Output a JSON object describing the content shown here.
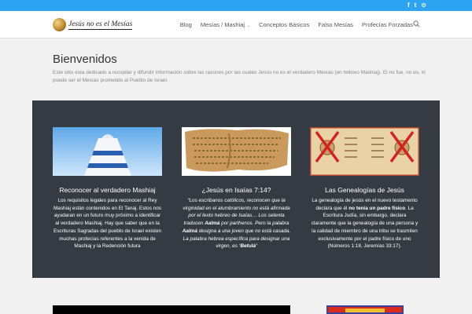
{
  "colors": {
    "accent": "#2ea3f2",
    "dark_panel": "#353b43"
  },
  "topbar": {
    "social": [
      {
        "icon": "facebook-icon",
        "glyph": "f"
      },
      {
        "icon": "twitter-icon",
        "glyph": "t"
      },
      {
        "icon": "rss-icon",
        "glyph": "⊙"
      }
    ]
  },
  "header": {
    "logo_text": "Jesús no es el Mesías",
    "nav": [
      {
        "label": "Blog",
        "has_submenu": false
      },
      {
        "label": "Mesías / Mashiaj",
        "has_submenu": true
      },
      {
        "label": "Conceptos Básicos",
        "has_submenu": false
      },
      {
        "label": "Falso Mesías",
        "has_submenu": false
      },
      {
        "label": "Profecías Forzadas",
        "has_submenu": true
      }
    ],
    "search_icon": "search-icon"
  },
  "intro": {
    "title": "Bienvenidos",
    "text": "Este sitio esta dedicado a recopilar y difundir información sobre las razones por las cuales Jesús no es el verdadero Mesías (en hebreo Mashiaj). El no fue, no es, ni puede ser el Mesías prometido al Pueblo de Israel."
  },
  "features": [
    {
      "title": "Reconocer al verdadero Mashiaj",
      "text": "Los requisitos legales para reconocer al Rey Mashiaj están contenidos en El Tanaj. Estos nos ayudaran en un futuro muy próximo a identificar al verdadero Mashiaj. Hay que saber que en la Escrituras Sagradas del pueblo de Israel existen muchas profecías referentes a la venida de Mashiaj y la Redención futura"
    },
    {
      "title": "¿Jesús en Isaías 7:14?",
      "text_a": "“Los escribanos católicos, reconocen que la virginidad en el alumbramiento no está afirmada por el texto hebreo de Isaías… Los setenta traducen ",
      "bold_a": "Aalmá",
      "text_b": " por parthenos. Pero la palabra ",
      "bold_b": "Aalmá",
      "text_c": " designa a una joven que no está casada. La palabra hebrea específica para designar una virgen, es ",
      "bold_c": "‘Betulá’"
    },
    {
      "title": "Las Genealogías de Jesús",
      "text_a": "La genealogía de jesús en el nuevo testamento declara que él ",
      "bold_a": "no tenía un padre físico",
      "text_b": ". La Escritura Judía, sin embargo, declara claramente que la genealogía de una persona y la calidad de miembro de una tribu se trasmiten exclusivamente por el padre físico de uno (Números 1:18, Jeremías 33:17)."
    }
  ]
}
